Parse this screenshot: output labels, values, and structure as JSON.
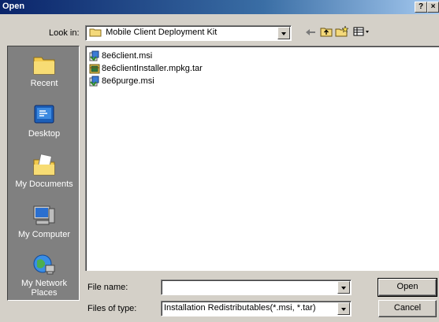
{
  "window": {
    "title": "Open",
    "help_label": "?",
    "close_label": "×"
  },
  "lookin": {
    "label": "Look in:",
    "value": "Mobile Client Deployment Kit"
  },
  "toolbar": {
    "icons": [
      "back-arrow-icon",
      "up-folder-icon",
      "new-folder-icon",
      "view-menu-icon"
    ]
  },
  "places": [
    {
      "label": "Recent",
      "icon": "recent-folder-icon"
    },
    {
      "label": "Desktop",
      "icon": "desktop-icon"
    },
    {
      "label": "My Documents",
      "icon": "my-documents-icon"
    },
    {
      "label": "My Computer",
      "icon": "my-computer-icon"
    },
    {
      "label": "My Network Places",
      "icon": "network-globe-icon"
    }
  ],
  "files": [
    {
      "name": "8e6client.msi",
      "icon": "msi-installer-icon"
    },
    {
      "name": "8e6clientInstaller.mpkg.tar",
      "icon": "archive-icon"
    },
    {
      "name": "8e6purge.msi",
      "icon": "msi-installer-icon"
    }
  ],
  "filename": {
    "label": "File name:",
    "value": ""
  },
  "filetype": {
    "label": "Files of type:",
    "value": "Installation Redistributables(*.msi, *.tar)"
  },
  "buttons": {
    "open": "Open",
    "cancel": "Cancel"
  }
}
